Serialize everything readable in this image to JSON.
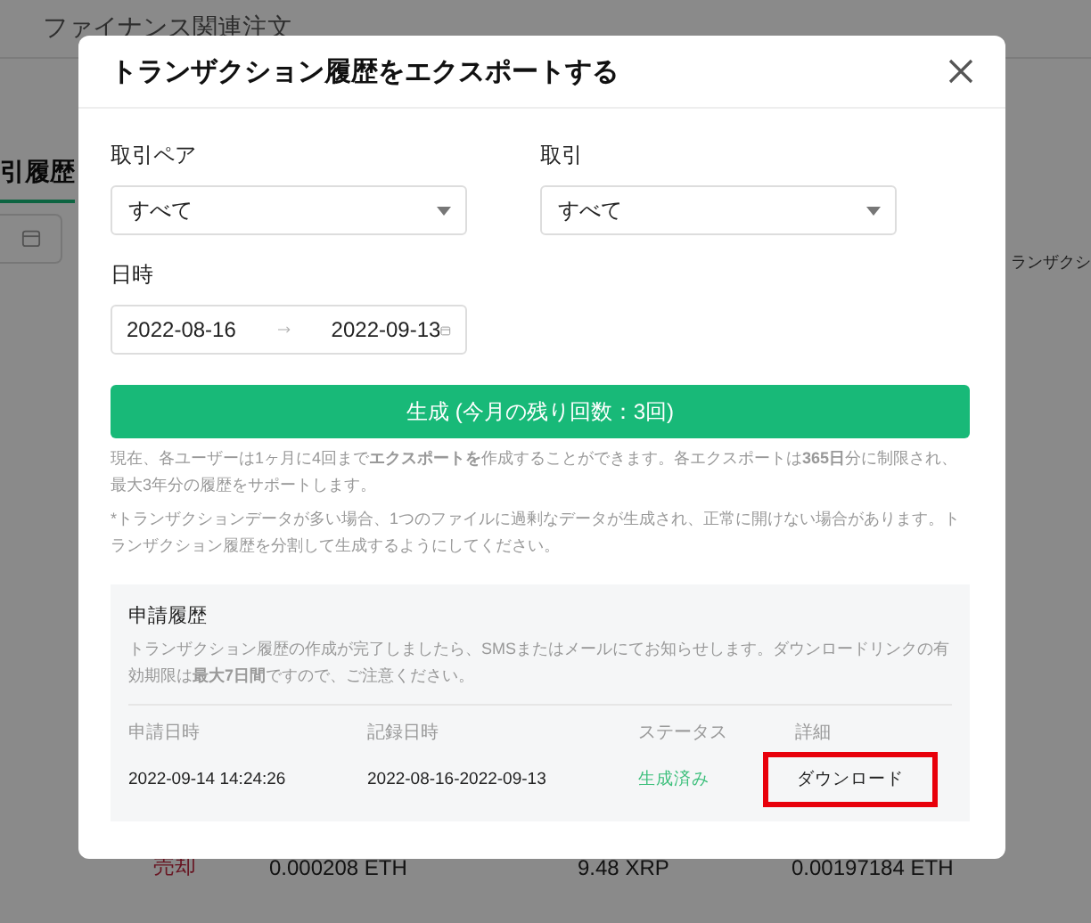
{
  "background": {
    "header_title": "ファイナンス関連注文",
    "tab": "引履歴",
    "column_text": "ランザクシ",
    "row": {
      "side": "売却",
      "cells": [
        "0.000208 ETH",
        "9.48 XRP",
        "0.00197184 ETH"
      ]
    }
  },
  "dialog": {
    "title": "トランザクション履歴をエクスポートする",
    "fields": [
      {
        "kind": "select",
        "label": "取引ペア",
        "value": "すべて"
      },
      {
        "kind": "select",
        "label": "取引",
        "value": "すべて"
      },
      {
        "kind": "daterange",
        "label": "日時",
        "start": "2022-08-16",
        "end": "2022-09-13"
      }
    ],
    "generate_button": "生成 (今月の残り回数：3回)",
    "notes": [
      "現在、各ユーザーは1ヶ月に4回まで**エクスポートを**作成することができます。各エクスポートは**365日**分に制限され、最大3年分の履歴をサポートします。",
      "*トランザクションデータが多い場合、1つのファイルに過剰なデータが生成され、正常に開けない場合があります。トランザクション履歴を分割して生成するようにしてください。"
    ],
    "history": {
      "title": "申請履歴",
      "description": "トランザクション履歴の作成が完了しましたら、SMSまたはメールにてお知らせします。ダウンロードリンクの有効期限は**最大7日間**ですので、ご注意ください。",
      "columns": [
        "申請日時",
        "記録日時",
        "ステータス",
        "詳細"
      ],
      "rows": [
        {
          "requested": "2022-09-14 14:24:26",
          "range": "2022-08-16-2022-09-13",
          "status": "生成済み",
          "detail": "ダウンロード",
          "highlighted": true
        }
      ]
    }
  }
}
